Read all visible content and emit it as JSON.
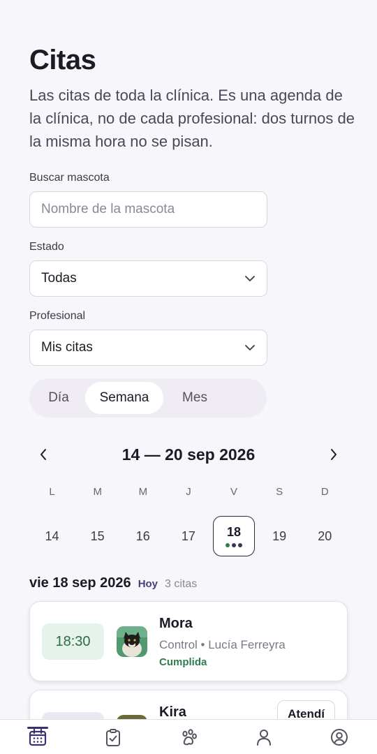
{
  "header": {
    "title": "Citas",
    "subtitle": "Las citas de toda la clínica. Es una agenda de la clínica, no de cada profesional: dos turnos de la misma hora no se pisan."
  },
  "filters": {
    "search": {
      "label": "Buscar mascota",
      "placeholder": "Nombre de la mascota",
      "value": ""
    },
    "status": {
      "label": "Estado",
      "value": "Todas"
    },
    "professional": {
      "label": "Profesional",
      "value": "Mis citas"
    }
  },
  "view_toggle": {
    "options": [
      {
        "label": "Día",
        "active": false
      },
      {
        "label": "Semana",
        "active": true
      },
      {
        "label": "Mes",
        "active": false
      }
    ]
  },
  "calendar": {
    "range": "14 — 20 sep 2026",
    "weekdays": [
      "L",
      "M",
      "M",
      "J",
      "V",
      "S",
      "D"
    ],
    "days": [
      {
        "num": "14",
        "selected": false
      },
      {
        "num": "15",
        "selected": false
      },
      {
        "num": "16",
        "selected": false
      },
      {
        "num": "17",
        "selected": false
      },
      {
        "num": "18",
        "selected": true,
        "dots": [
          "#2e7d4f",
          "#3c3550",
          "#3c3550"
        ]
      },
      {
        "num": "19",
        "selected": false
      },
      {
        "num": "20",
        "selected": false
      }
    ]
  },
  "day_summary": {
    "date": "vie 18 sep 2026",
    "today_label": "Hoy",
    "count": "3 citas"
  },
  "appointments": [
    {
      "time": "18:30",
      "pet": "Mora",
      "detail": "Control • Lucía Ferreyra",
      "status": "Cumplida",
      "time_bg": "#e6f3ea",
      "time_color": "#2e6b48"
    },
    {
      "pet": "Kira",
      "action": "Atendí",
      "time_bg": "#ebe8f4"
    }
  ],
  "bottom_nav": [
    {
      "icon": "calendar-icon",
      "active": true
    },
    {
      "icon": "clipboard-check-icon",
      "active": false
    },
    {
      "icon": "paw-icon",
      "active": false
    },
    {
      "icon": "person-icon",
      "active": false
    },
    {
      "icon": "account-circle-icon",
      "active": false
    }
  ],
  "colors": {
    "accent": "#3c2f6e",
    "success": "#2e7d4f",
    "background": "#f7f6fa"
  }
}
